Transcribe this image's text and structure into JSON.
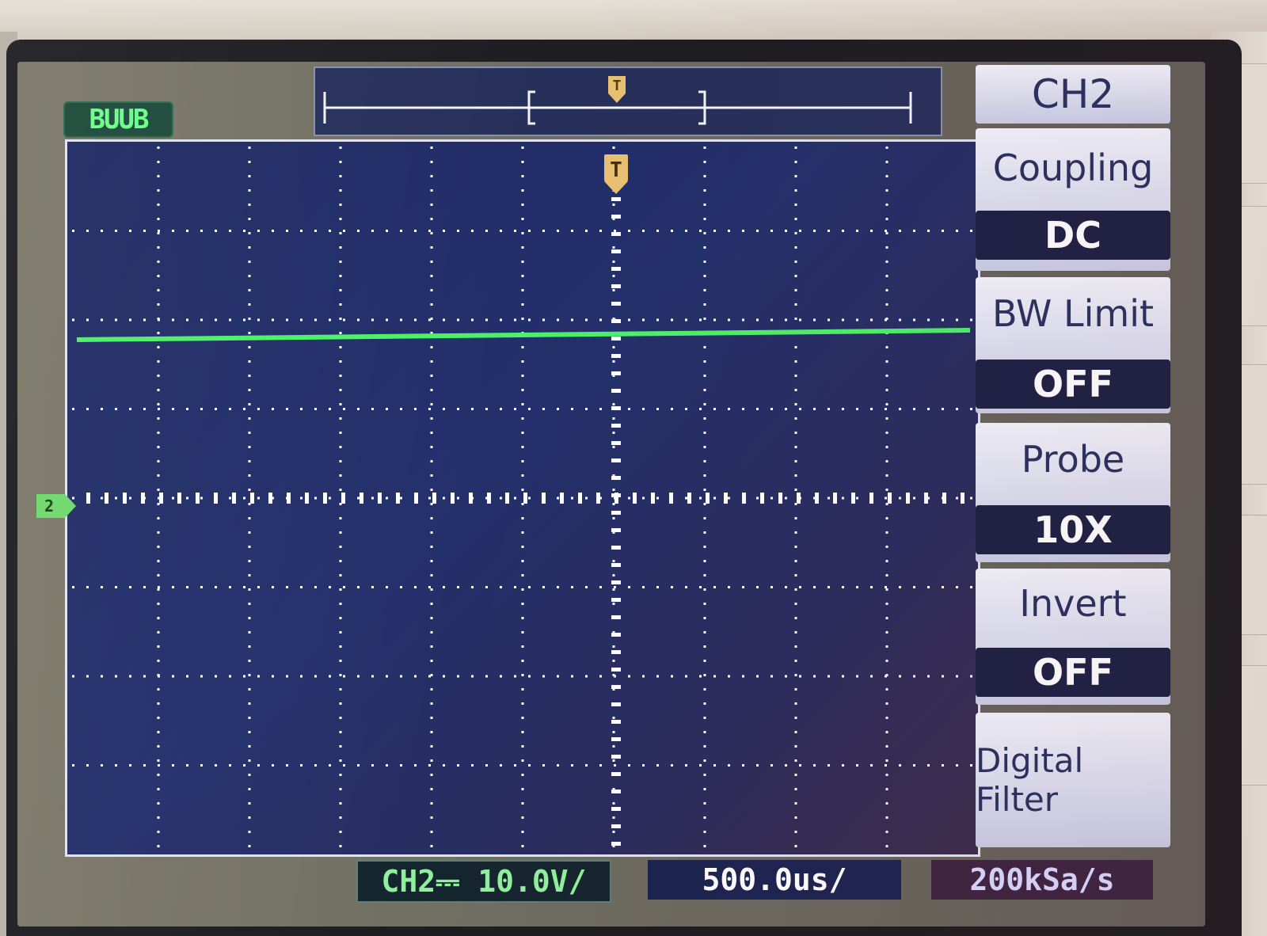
{
  "status": {
    "text": "BUUB"
  },
  "menu": {
    "title": "CH2",
    "coupling_label": "Coupling",
    "coupling_value": "DC",
    "bw_limit_label": "BW Limit",
    "bw_limit_value": "OFF",
    "probe_label": "Probe",
    "probe_value": "10X",
    "invert_label": "Invert",
    "invert_value": "OFF",
    "digital_filter_label": "Digital Filter"
  },
  "bottom_bar": {
    "channel_scale": "CH2⎓  10.0V/",
    "timebase": "500.0us/",
    "sample_rate": "200kSa/s"
  },
  "markers": {
    "trigger": "T",
    "channel_ground": "2"
  },
  "colors": {
    "trace": "#4cf06a",
    "grid": "#ffffff",
    "trigger_marker": "#e8c070",
    "screen_bg": "#22306a"
  },
  "icons": {
    "trigger_position": "trigger-T-icon",
    "channel_marker": "channel-2-marker-icon"
  }
}
